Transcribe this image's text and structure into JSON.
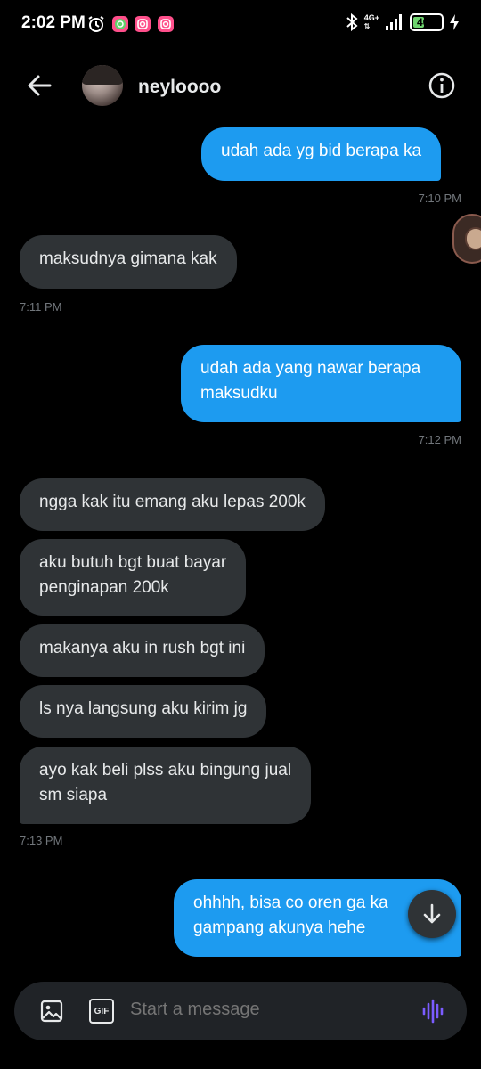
{
  "status_bar": {
    "time": "2:02 PM",
    "network": "4G+",
    "battery": "40",
    "battery_level": 0.4,
    "icons": [
      "alarm-icon",
      "whatsapp-icon",
      "instagram-icon",
      "instagram-icon",
      "bluetooth-icon",
      "signal-icon",
      "battery-icon",
      "charging-icon"
    ]
  },
  "header": {
    "username": "neyloooo",
    "back_icon": "arrow-left-icon",
    "info_icon": "info-icon"
  },
  "messages": [
    {
      "direction": "out",
      "text": "udah ada yg bid berapa ka"
    },
    {
      "type": "timestamp",
      "align": "right",
      "text": "7:10 PM"
    },
    {
      "direction": "in",
      "text": "maksudnya gimana kak"
    },
    {
      "type": "timestamp",
      "align": "left",
      "text": "7:11 PM"
    },
    {
      "direction": "out",
      "text_lines": [
        "udah ada yang nawar berapa",
        "maksudku"
      ]
    },
    {
      "type": "timestamp",
      "align": "right",
      "text": "7:12 PM"
    },
    {
      "direction": "in",
      "text": "ngga kak itu emang aku lepas 200k"
    },
    {
      "direction": "in",
      "text_lines": [
        "aku butuh bgt buat bayar",
        "penginapan 200k"
      ]
    },
    {
      "direction": "in",
      "text": "makanya aku in rush bgt ini"
    },
    {
      "direction": "in",
      "text": "ls nya langsung aku kirim jg"
    },
    {
      "direction": "in",
      "text_lines": [
        "ayo kak beli plss aku bingung jual",
        "sm siapa"
      ]
    },
    {
      "type": "timestamp",
      "align": "left",
      "text": "7:13 PM"
    },
    {
      "direction": "out",
      "text_lines": [
        "ohhhh, bisa co oren ga ka",
        "gampang akunya hehe"
      ]
    }
  ],
  "composer": {
    "placeholder": "Start a message",
    "gif_label": "GIF",
    "image_icon": "image-icon",
    "voice_icon": "voice-wave-icon"
  },
  "fab_icon": "arrow-down-icon",
  "colors": {
    "background": "#000000",
    "outgoing_bubble": "#1d9bf0",
    "incoming_bubble": "#2f3336",
    "timestamp": "#71767b",
    "voice_accent": "#7b5cff"
  }
}
